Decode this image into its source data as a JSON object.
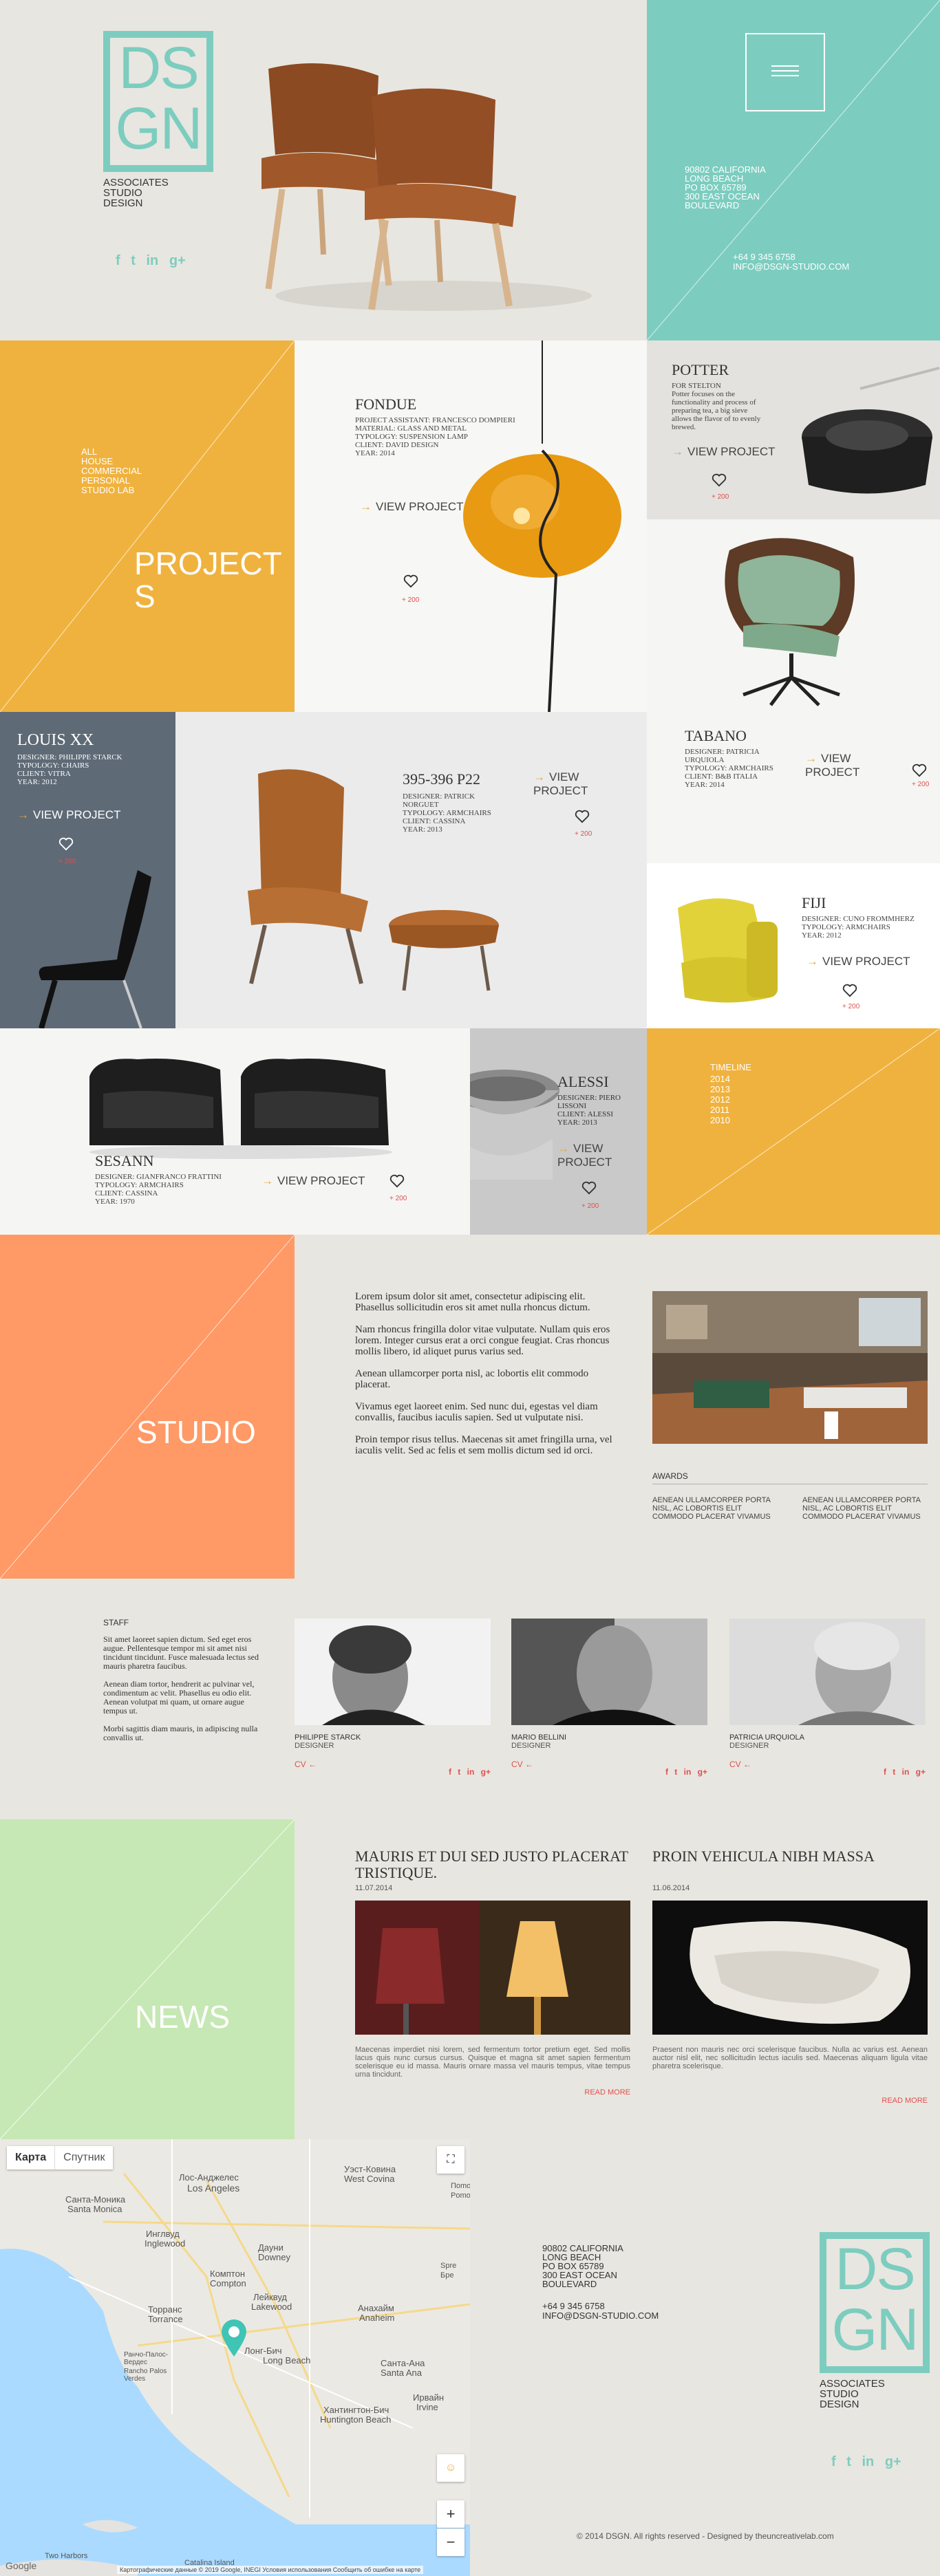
{
  "brand": {
    "logo_lines": [
      "DS",
      "GN"
    ],
    "tagline": [
      "ASSOCIATES",
      "STUDIO",
      "DESIGN"
    ],
    "teal": "#7ccdbf",
    "orange": "#f0b23e",
    "salmon": "#ff9966",
    "green": "#c6e8b4"
  },
  "social": {
    "facebook": "f",
    "twitter": "t",
    "linkedin": "in",
    "google": "g+"
  },
  "header": {
    "menu_icon": "hamburger-icon",
    "address_lines": [
      "90802 CALIFORNIA",
      "LONG BEACH",
      "PO BOX 65789",
      "300 EAST OCEAN",
      "BOULEVARD"
    ],
    "phone": "+64 9 345 6758",
    "email": "INFO@DSGN-STUDIO.COM"
  },
  "projects": {
    "title": "PROJECT S",
    "filters": [
      "ALL",
      "HOUSE",
      "COMMERCIAL",
      "PERSONAL",
      "STUDIO LAB"
    ],
    "view_label": "VIEW PROJECT",
    "items": {
      "fondue": {
        "name": "FONDUE",
        "meta": [
          "PROJECT ASSISTANT: FRANCESCO DOMPIERI",
          "MATERIAL: GLASS AND METAL",
          "TYPOLOGY: SUSPENSION LAMP",
          "CLIENT: DAVID DESIGN",
          "YEAR: 2014"
        ],
        "likes": "+ 200"
      },
      "potter": {
        "name": "POTTER",
        "meta": [
          "FOR STELTON",
          "Potter focuses on the",
          "functionality and process of",
          "preparing tea, a big sieve",
          "allows the flavor of to evenly",
          "brewed."
        ],
        "likes": "+ 200"
      },
      "louis": {
        "name": "LOUIS XX",
        "meta": [
          "DESIGNER: PHILIPPE STARCK",
          "TYPOLOGY: CHAIRS",
          "CLIENT: VITRA",
          "YEAR: 2012"
        ],
        "likes": "+ 200"
      },
      "p22": {
        "name": "395-396 P22",
        "meta": [
          "DESIGNER: PATRICK",
          "NORGUET",
          "TYPOLOGY: ARMCHAIRS",
          "CLIENT: CASSINA",
          "YEAR: 2013"
        ],
        "likes": "+ 200"
      },
      "tabano": {
        "name": "TABANO",
        "meta": [
          "DESIGNER: PATRICIA",
          "URQUIOLA",
          "TYPOLOGY: ARMCHAIRS",
          "CLIENT: B&B ITALIA",
          "YEAR: 2014"
        ],
        "likes": "+ 200"
      },
      "fiji": {
        "name": "FIJI",
        "meta": [
          "DESIGNER: CUNO FROMMHERZ",
          "TYPOLOGY: ARMCHAIRS",
          "YEAR: 2012"
        ],
        "likes": "+ 200"
      },
      "sesann": {
        "name": "SESANN",
        "meta": [
          "DESIGNER: GIANFRANCO FRATTINI",
          "TYPOLOGY: ARMCHAIRS",
          "CLIENT: CASSINA",
          "YEAR: 1970"
        ],
        "likes": "+ 200"
      },
      "alessi": {
        "name": "ALESSI",
        "meta": [
          "DESIGNER: PIERO",
          "LISSONI",
          "CLIENT: ALESSI",
          "YEAR: 2013"
        ],
        "likes": "+ 200"
      }
    },
    "timeline_title": "TIMELINE",
    "timeline_years": [
      "2014",
      "2013",
      "2012",
      "2011",
      "2010"
    ]
  },
  "studio": {
    "title": "STUDIO",
    "paragraphs": [
      "Lorem ipsum dolor sit amet, consectetur adipiscing elit. Phasellus sollicitudin eros sit amet nulla rhoncus dictum.",
      "Nam rhoncus fringilla dolor vitae vulputate. Nullam quis eros lorem. Integer cursus erat a orci congue feugiat. Cras rhoncus mollis libero, id aliquet purus varius sed.",
      "Aenean ullamcorper porta nisl, ac lobortis elit commodo placerat.",
      "Vivamus eget laoreet enim. Sed nunc dui, egestas vel diam convallis, faucibus iaculis sapien. Sed ut vulputate nisi.",
      "Proin tempor risus tellus. Maecenas sit amet fringilla urna, vel iaculis velit. Sed ac felis et sem mollis dictum sed id orci."
    ],
    "awards_title": "AWARDS",
    "awards": [
      "AENEAN ULLAMCORPER PORTA NISL, AC LOBORTIS ELIT COMMODO PLACERAT VIVAMUS",
      "AENEAN ULLAMCORPER PORTA NISL, AC LOBORTIS ELIT COMMODO PLACERAT VIVAMUS"
    ]
  },
  "staff": {
    "title": "STAFF",
    "paragraphs": [
      "Sit amet laoreet sapien dictum. Sed eget eros augue. Pellentesque tempor mi sit amet nisi tincidunt tincidunt. Fusce malesuada lectus sed mauris pharetra faucibus.",
      "Aenean diam tortor, hendrerit ac pulvinar vel, condimentum ac velit. Phasellus eu odio elit. Aenean volutpat mi quam, ut ornare augue tempus ut.",
      "Morbi sagittis diam mauris, in adipiscing nulla convallis ut."
    ],
    "cv_label": "CV",
    "members": [
      {
        "name": "PHILIPPE STARCK",
        "role": "DESIGNER"
      },
      {
        "name": "MARIO BELLINI",
        "role": "DESIGNER"
      },
      {
        "name": "PATRICIA URQUIOLA",
        "role": "DESIGNER"
      }
    ]
  },
  "news": {
    "title": "NEWS",
    "read_more": "READ MORE",
    "articles": [
      {
        "title": "MAURIS ET DUI SED JUSTO PLACERAT TRISTIQUE.",
        "date": "11.07.2014",
        "text": "Maecenas imperdiet nisi lorem, sed fermentum tortor pretium eget. Sed mollis lacus quis nunc cursus cursus. Quisque et magna sit amet sapien fermentum scelerisque eu id massa. Mauris ornare massa vel mauris tempus, vitae tempus urna tincidunt."
      },
      {
        "title": "PROIN VEHICULA NIBH MASSA",
        "date": "11.06.2014",
        "text": "Praesent non mauris nec orci scelerisque faucibus. Nulla ac varius est. Aenean auctor nisl elit, nec sollicitudin lectus iaculis sed. Maecenas aliquam ligula vitae pharetra scelerisque."
      }
    ]
  },
  "map": {
    "tab_map": "Карта",
    "tab_satellite": "Спутник",
    "places": [
      "Лос-Анджелес",
      "Los Angeles",
      "Санта-Моника",
      "Santa Monica",
      "Инглвуд",
      "Inglewood",
      "Дауни",
      "Downey",
      "Комптон",
      "Compton",
      "Лейквуд",
      "Lakewood",
      "Торранс",
      "Torrance",
      "Анахайм",
      "Anaheim",
      "Санта-Ана",
      "Santa Ana",
      "Ирвайн",
      "Irvine",
      "Хантингтон-Бич",
      "Huntington Beach",
      "Уэст-Ковина",
      "West Covina",
      "Ранчо-Палос-Вердес",
      "Rancho Palos Verdes",
      "Лонг-Бич",
      "Long Beach",
      "Two Harbors",
      "Catalina Island",
      "Поmo",
      "Pomo",
      "Spre",
      "Бре"
    ],
    "attribution": "Картографические данные © 2019 Google, INEGI   Условия использования   Сообщить об ошибке на карте",
    "google": "Google",
    "zoom_in": "+",
    "zoom_out": "−",
    "fullscreen": "⛶"
  },
  "footer": {
    "address_lines": [
      "90802 CALIFORNIA",
      "LONG BEACH",
      "PO BOX 65789",
      "300 EAST OCEAN",
      "BOULEVARD"
    ],
    "phone": "+64 9 345 6758",
    "email": "INFO@DSGN-STUDIO.COM",
    "copyright": "© 2014 DSGN.  All rights reserved - Designed by theuncreativelab.com"
  }
}
